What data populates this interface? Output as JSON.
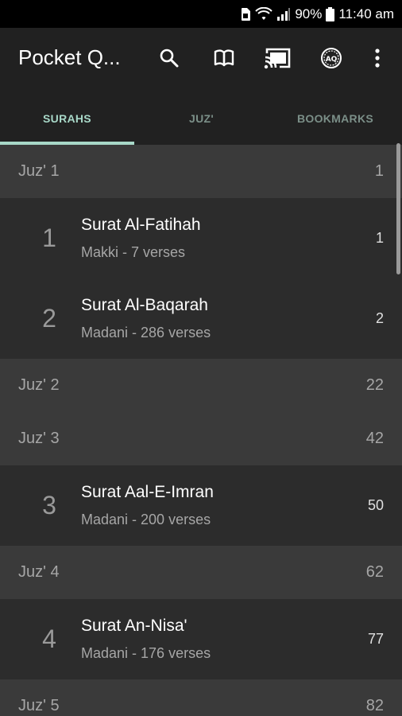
{
  "status_bar": {
    "battery": "90%",
    "time": "11:40 am"
  },
  "app_bar": {
    "title": "Pocket Q...",
    "actions": [
      "search-icon",
      "book-open-icon",
      "cast-icon",
      "translate-icon",
      "more-vert-icon"
    ]
  },
  "tabs": [
    {
      "label": "SURAHS",
      "active": true
    },
    {
      "label": "JUZ'",
      "active": false
    },
    {
      "label": "BOOKMARKS",
      "active": false
    }
  ],
  "list": [
    {
      "type": "juz",
      "label": "Juz' 1",
      "page": "1"
    },
    {
      "type": "surah",
      "number": "1",
      "name": "Surat Al-Fatihah",
      "meta": "Makki - 7 verses",
      "page": "1"
    },
    {
      "type": "surah",
      "number": "2",
      "name": "Surat Al-Baqarah",
      "meta": "Madani - 286 verses",
      "page": "2"
    },
    {
      "type": "juz",
      "label": "Juz' 2",
      "page": "22"
    },
    {
      "type": "juz",
      "label": "Juz' 3",
      "page": "42"
    },
    {
      "type": "surah",
      "number": "3",
      "name": "Surat Aal-E-Imran",
      "meta": "Madani - 200 verses",
      "page": "50"
    },
    {
      "type": "juz",
      "label": "Juz' 4",
      "page": "62"
    },
    {
      "type": "surah",
      "number": "4",
      "name": "Surat An-Nisa'",
      "meta": "Madani - 176 verses",
      "page": "77"
    },
    {
      "type": "juz",
      "label": "Juz' 5",
      "page": "82"
    }
  ]
}
